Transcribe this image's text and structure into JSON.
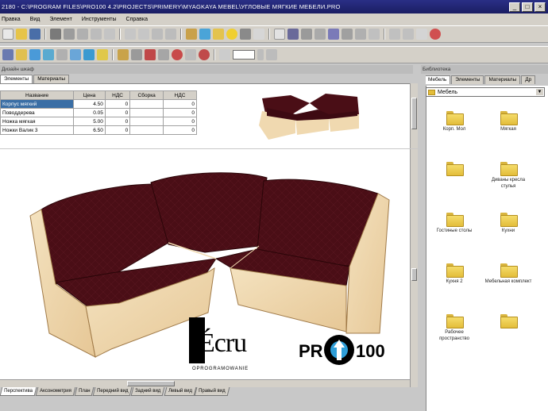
{
  "window": {
    "title": "2180 - C:\\PROGRAM FILES\\PRO100 4.2\\PROJECTS\\PRIMERY\\MYAGKAYA MEBEL\\УГЛОВЫЕ МЯГКИЕ МЕБЕЛИ.PRO",
    "min": "_",
    "max": "□",
    "close": "×"
  },
  "menu": {
    "items": [
      "Правка",
      "Вид",
      "Элемент",
      "Инструменты",
      "Справка"
    ]
  },
  "properties_panel": {
    "title": "Дизайн шкаф",
    "tabs": [
      "Элементы",
      "Материалы"
    ],
    "columns": [
      "Название",
      "Цена",
      "НДС",
      "Сборка",
      "НДС"
    ],
    "rows": [
      [
        "Корпус мягкий",
        "4.50",
        "0",
        "",
        "0"
      ],
      [
        "Поводдерева",
        "0.05",
        "0",
        "",
        "0"
      ],
      [
        "Ножка мягкая",
        "5.00",
        "0",
        "",
        "0"
      ],
      [
        "Ножки Валик 3",
        "6.50",
        "0",
        "",
        "0"
      ]
    ]
  },
  "viewport": {
    "logo_ecru": "Écru",
    "logo_ecru_sub": "OPROGRAMOWANIE",
    "logo_pro_left": "PR",
    "logo_pro_right": "100"
  },
  "bottom_tabs": [
    "Перспектива",
    "Аксонометрия",
    "План",
    "Передний вид",
    "Задний вид",
    "Левый вид",
    "Правый вид"
  ],
  "library": {
    "title": "Библиотека",
    "tabs": [
      "Мебель",
      "Элементы",
      "Материалы",
      "Др"
    ],
    "path": "Мебель",
    "items": [
      {
        "label": "Корп. Мол"
      },
      {
        "label": "Мягкая"
      },
      {
        "label": ""
      },
      {
        "label": "Диваны кресла стулья"
      },
      {
        "label": "Гостиные столы"
      },
      {
        "label": "Кухни"
      },
      {
        "label": "Кухня 2"
      },
      {
        "label": "Мебельная комплект"
      },
      {
        "label": "Рабочее пространство"
      },
      {
        "label": ""
      }
    ]
  },
  "colors": {
    "upholstery": "#4a0e16",
    "wood": "#f0d9b0",
    "titlebar": "#1f2270"
  }
}
